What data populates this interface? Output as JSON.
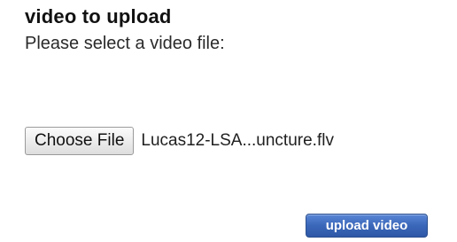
{
  "form": {
    "heading": "video to upload",
    "prompt": "Please select a video file:",
    "file_input": {
      "button_label": "Choose File",
      "selected_file": "Lucas12-LSA...uncture.flv"
    },
    "submit_label": "upload video",
    "colors": {
      "submit_background": "#3b67ba",
      "submit_text": "#ffffff"
    }
  }
}
